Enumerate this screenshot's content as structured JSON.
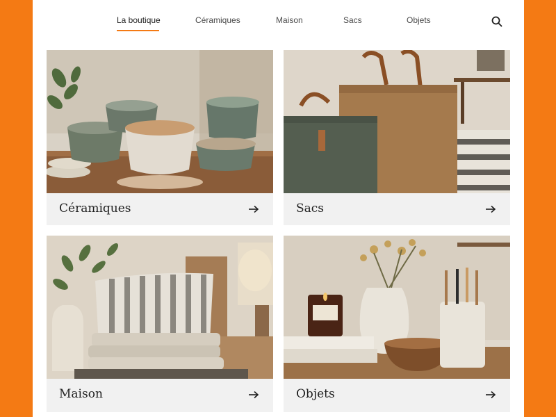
{
  "nav": {
    "items": [
      {
        "label": "La boutique",
        "active": true
      },
      {
        "label": "Céramiques",
        "active": false
      },
      {
        "label": "Maison",
        "active": false
      },
      {
        "label": "Sacs",
        "active": false
      },
      {
        "label": "Objets",
        "active": false
      }
    ],
    "search_icon": "search-icon",
    "accent_color": "#f47a14"
  },
  "cards": [
    {
      "label": "Céramiques",
      "image": "ceramic-bowls-photo",
      "arrow_icon": "arrow-right-icon"
    },
    {
      "label": "Sacs",
      "image": "canvas-tote-bags-photo",
      "arrow_icon": "arrow-right-icon"
    },
    {
      "label": "Maison",
      "image": "striped-pillows-linens-photo",
      "arrow_icon": "arrow-right-icon"
    },
    {
      "label": "Objets",
      "image": "candle-vases-toothbrushes-photo",
      "arrow_icon": "arrow-right-icon"
    }
  ],
  "colors": {
    "background": "#f47a14",
    "panel": "#ffffff",
    "card_footer": "#f1f1f1"
  }
}
